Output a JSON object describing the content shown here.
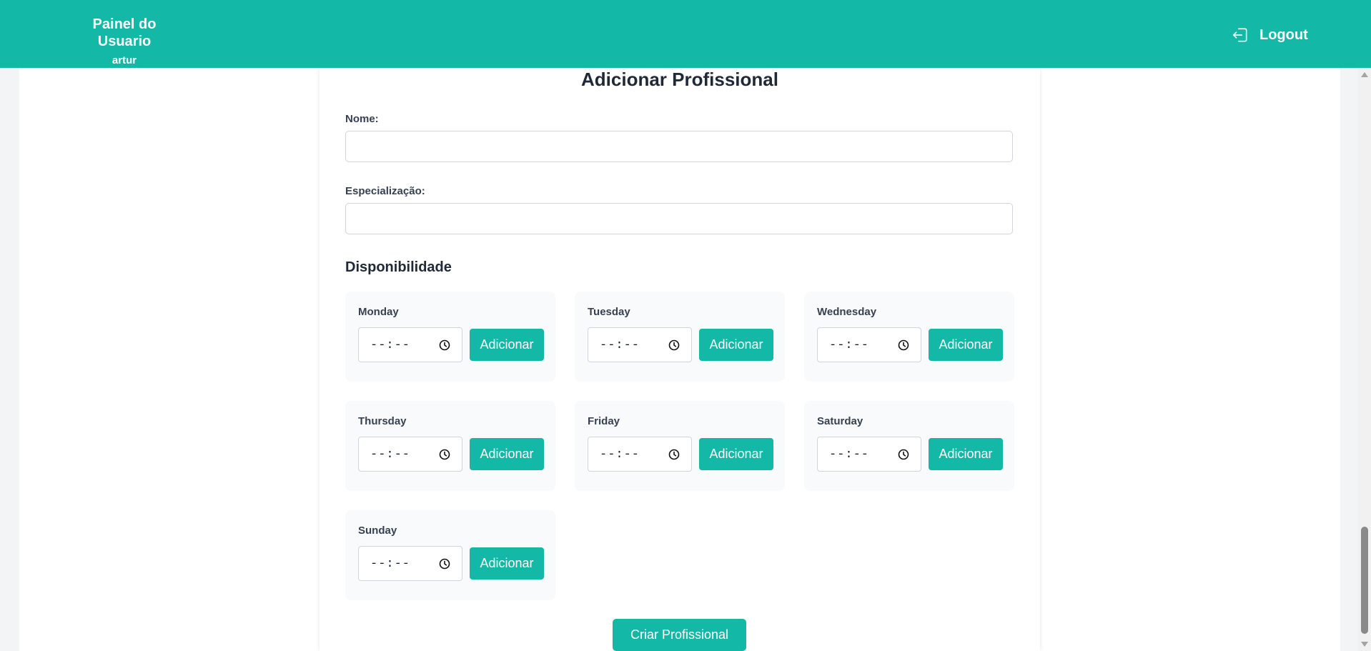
{
  "header": {
    "title": "Painel do Usuario",
    "username": "artur",
    "logout_label": "Logout",
    "logout_icon": "logout-icon"
  },
  "colors": {
    "accent": "#14b8a6",
    "page_background": "#f3f4f6",
    "card_background": "#ffffff",
    "day_box_background": "#f9fafb"
  },
  "form": {
    "title": "Adicionar Profissional",
    "name_label": "Nome:",
    "name_value": "",
    "specialization_label": "Especialização:",
    "specialization_value": "",
    "availability_title": "Disponibilidade",
    "days": [
      {
        "name": "Monday",
        "time_value": "--:--",
        "add_label": "Adicionar"
      },
      {
        "name": "Tuesday",
        "time_value": "--:--",
        "add_label": "Adicionar"
      },
      {
        "name": "Wednesday",
        "time_value": "--:--",
        "add_label": "Adicionar"
      },
      {
        "name": "Thursday",
        "time_value": "--:--",
        "add_label": "Adicionar"
      },
      {
        "name": "Friday",
        "time_value": "--:--",
        "add_label": "Adicionar"
      },
      {
        "name": "Saturday",
        "time_value": "--:--",
        "add_label": "Adicionar"
      },
      {
        "name": "Sunday",
        "time_value": "--:--",
        "add_label": "Adicionar"
      }
    ],
    "submit_label": "Criar Profissional"
  }
}
